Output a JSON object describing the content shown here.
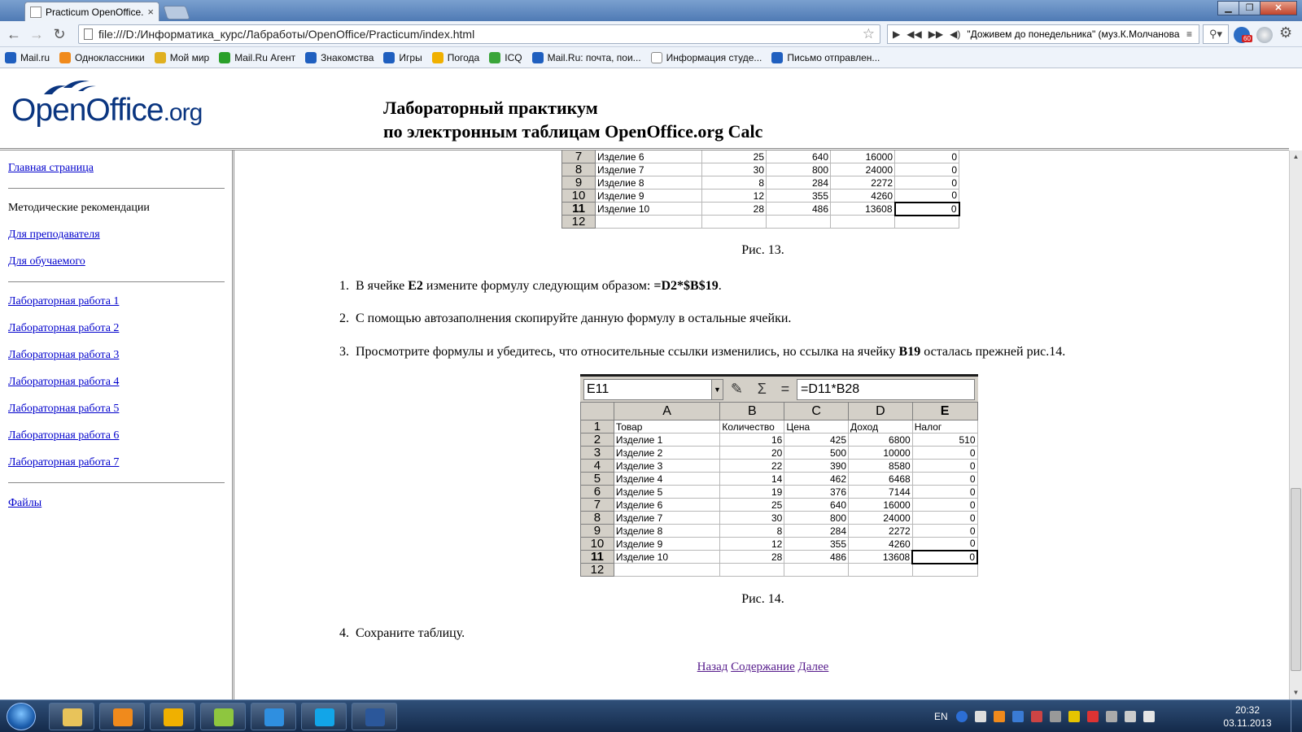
{
  "browser": {
    "tab_title": "Practicum OpenOffice.org",
    "url": "file:///D:/Информатика_курс/Лабработы/OpenOffice/Practicum/index.html",
    "media_title": "\"Доживем до понедельника\" (муз.К.Молчанова",
    "ext_badge": "60",
    "bookmarks": [
      {
        "label": "Mail.ru",
        "color": "#1f5fbf"
      },
      {
        "label": "Одноклассники",
        "color": "#f08a1c"
      },
      {
        "label": "Мой мир",
        "color": "#e0b020"
      },
      {
        "label": "Mail.Ru Агент",
        "color": "#2aa02a"
      },
      {
        "label": "Знакомства",
        "color": "#1f5fbf"
      },
      {
        "label": "Игры",
        "color": "#1f5fbf"
      },
      {
        "label": "Погода",
        "color": "#f0b000"
      },
      {
        "label": "ICQ",
        "color": "#3aa53a"
      },
      {
        "label": "Mail.Ru: почта, пои...",
        "color": "#1f5fbf"
      },
      {
        "label": "Информация студе...",
        "color": "#ffffff"
      },
      {
        "label": "Письмо отправлен...",
        "color": "#1f5fbf"
      }
    ]
  },
  "header": {
    "logo_main": "OpenOffice",
    "logo_org": ".org",
    "title_line1": "Лабораторный практикум",
    "title_line2": "по электронным таблицам OpenOffice.org Calc"
  },
  "sidebar": {
    "home": "Главная страница",
    "methods_heading": "Методические рекомендации",
    "for_teacher": "Для преподавателя",
    "for_student": "Для обучаемого",
    "labs": [
      "Лабораторная работа 1",
      "Лабораторная работа 2",
      "Лабораторная работа 3",
      "Лабораторная работа 4",
      "Лабораторная работа 5",
      "Лабораторная работа 6",
      "Лабораторная работа 7"
    ],
    "files": "Файлы"
  },
  "content": {
    "fig13": {
      "caption": "Рис. 13.",
      "rows": [
        {
          "n": "7",
          "name": "Изделие 6",
          "qty": "25",
          "price": "640",
          "income": "16000",
          "tax": "0"
        },
        {
          "n": "8",
          "name": "Изделие 7",
          "qty": "30",
          "price": "800",
          "income": "24000",
          "tax": "0"
        },
        {
          "n": "9",
          "name": "Изделие 8",
          "qty": "8",
          "price": "284",
          "income": "2272",
          "tax": "0"
        },
        {
          "n": "10",
          "name": "Изделие 9",
          "qty": "12",
          "price": "355",
          "income": "4260",
          "tax": "0"
        },
        {
          "n": "11",
          "name": "Изделие 10",
          "qty": "28",
          "price": "486",
          "income": "13608",
          "tax": "0"
        },
        {
          "n": "12",
          "name": "",
          "qty": "",
          "price": "",
          "income": "",
          "tax": ""
        }
      ]
    },
    "steps": {
      "s1_num": "1.",
      "s1_a": "В ячейке ",
      "s1_b": "E2",
      "s1_c": " измените формулу следующим образом: ",
      "s1_d": "=D2*$B$19",
      "s1_e": ".",
      "s2_num": "2.",
      "s2": "С помощью автозаполнения скопируйте данную формулу в остальные ячейки.",
      "s3_num": "3.",
      "s3_a": "Просмотрите формулы и убедитесь, что относительные ссылки изменились, но ссылка на ячейку ",
      "s3_b": "B19",
      "s3_c": " осталась прежней рис.14.",
      "s4_num": "4.",
      "s4": "Сохраните таблицу."
    },
    "fig14": {
      "caption": "Рис. 14.",
      "cell_ref": "E11",
      "formula": "=D11*B28",
      "columns": [
        "A",
        "B",
        "C",
        "D",
        "E"
      ],
      "rows": [
        {
          "n": "1",
          "name": "Товар",
          "qty": "Количество",
          "price": "Цена",
          "income": "Доход",
          "tax": "Налог"
        },
        {
          "n": "2",
          "name": "Изделие 1",
          "qty": "16",
          "price": "425",
          "income": "6800",
          "tax": "510"
        },
        {
          "n": "3",
          "name": "Изделие 2",
          "qty": "20",
          "price": "500",
          "income": "10000",
          "tax": "0"
        },
        {
          "n": "4",
          "name": "Изделие 3",
          "qty": "22",
          "price": "390",
          "income": "8580",
          "tax": "0"
        },
        {
          "n": "5",
          "name": "Изделие 4",
          "qty": "14",
          "price": "462",
          "income": "6468",
          "tax": "0"
        },
        {
          "n": "6",
          "name": "Изделие 5",
          "qty": "19",
          "price": "376",
          "income": "7144",
          "tax": "0"
        },
        {
          "n": "7",
          "name": "Изделие 6",
          "qty": "25",
          "price": "640",
          "income": "16000",
          "tax": "0"
        },
        {
          "n": "8",
          "name": "Изделие 7",
          "qty": "30",
          "price": "800",
          "income": "24000",
          "tax": "0"
        },
        {
          "n": "9",
          "name": "Изделие 8",
          "qty": "8",
          "price": "284",
          "income": "2272",
          "tax": "0"
        },
        {
          "n": "10",
          "name": "Изделие 9",
          "qty": "12",
          "price": "355",
          "income": "4260",
          "tax": "0"
        },
        {
          "n": "11",
          "name": "Изделие 10",
          "qty": "28",
          "price": "486",
          "income": "13608",
          "tax": "0"
        },
        {
          "n": "12",
          "name": "",
          "qty": "",
          "price": "",
          "income": "",
          "tax": ""
        }
      ]
    },
    "nav": {
      "back": "Назад",
      "contents": "Содержание",
      "next": "Далее"
    }
  },
  "taskbar": {
    "lang": "EN",
    "time": "20:32",
    "date": "03.11.2013",
    "apps": [
      {
        "name": "explorer",
        "color": "#e8c35a"
      },
      {
        "name": "media-player",
        "color": "#f08a1c"
      },
      {
        "name": "mail-agent",
        "color": "#f0b000"
      },
      {
        "name": "picasa",
        "color": "#8ec63f"
      },
      {
        "name": "internet-explorer",
        "color": "#2f8fe0"
      },
      {
        "name": "skype",
        "color": "#12a5e8"
      },
      {
        "name": "word",
        "color": "#2b579a"
      }
    ]
  }
}
